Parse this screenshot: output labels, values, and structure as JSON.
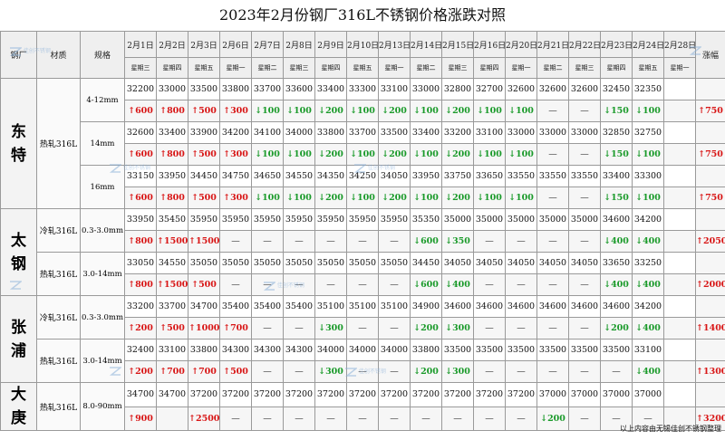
{
  "title": "2023年2月份钢厂316L不锈钢价格涨跌对照",
  "headers": {
    "mill": "钢厂",
    "material": "材质",
    "spec": "规格",
    "dates": [
      "2月1日",
      "2月2日",
      "2月3日",
      "2月6日",
      "2月7日",
      "2月8日",
      "2月9日",
      "2月10日",
      "2月13日",
      "2月14日",
      "2月15日",
      "2月16日",
      "2月20日",
      "2月21日",
      "2月22日",
      "2月23日",
      "2月24日",
      "2月28日"
    ],
    "total": "涨幅"
  },
  "weekdays": [
    "星期三",
    "星期四",
    "星期五",
    "星期一",
    "星期二",
    "星期三",
    "星期四",
    "星期五",
    "星期一",
    "星期二",
    "星期三",
    "星期四",
    "星期一",
    "星期二",
    "星期三",
    "星期四",
    "星期五",
    "星期一"
  ],
  "groups": [
    {
      "mill": "东特",
      "rows": [
        {
          "material": "热轧316L",
          "spec": "4-12mm",
          "prices": [
            "32200",
            "33000",
            "33500",
            "33800",
            "33700",
            "33600",
            "33400",
            "33300",
            "33100",
            "33000",
            "32800",
            "32700",
            "32600",
            "32600",
            "32600",
            "32450",
            "32350",
            ""
          ],
          "changes": [
            [
              "up",
              "600"
            ],
            [
              "up",
              "800"
            ],
            [
              "up",
              "500"
            ],
            [
              "up",
              "300"
            ],
            [
              "dn",
              "100"
            ],
            [
              "dn",
              "100"
            ],
            [
              "dn",
              "200"
            ],
            [
              "dn",
              "100"
            ],
            [
              "dn",
              "200"
            ],
            [
              "dn",
              "100"
            ],
            [
              "dn",
              "200"
            ],
            [
              "dn",
              "100"
            ],
            [
              "dn",
              "100"
            ],
            [
              "eq",
              "—"
            ],
            [
              "eq",
              "—"
            ],
            [
              "dn",
              "150"
            ],
            [
              "dn",
              "100"
            ],
            [
              "",
              ""
            ]
          ],
          "total": "750"
        },
        {
          "material": "",
          "spec": "14mm",
          "prices": [
            "32600",
            "33400",
            "33900",
            "34200",
            "34100",
            "34000",
            "33800",
            "33700",
            "33500",
            "33400",
            "33200",
            "33100",
            "33000",
            "33000",
            "33000",
            "32850",
            "32750",
            ""
          ],
          "changes": [
            [
              "up",
              "600"
            ],
            [
              "up",
              "800"
            ],
            [
              "up",
              "500"
            ],
            [
              "up",
              "300"
            ],
            [
              "dn",
              "100"
            ],
            [
              "dn",
              "100"
            ],
            [
              "dn",
              "200"
            ],
            [
              "dn",
              "100"
            ],
            [
              "dn",
              "200"
            ],
            [
              "dn",
              "100"
            ],
            [
              "dn",
              "200"
            ],
            [
              "dn",
              "100"
            ],
            [
              "dn",
              "100"
            ],
            [
              "eq",
              "—"
            ],
            [
              "eq",
              "—"
            ],
            [
              "dn",
              "150"
            ],
            [
              "dn",
              "100"
            ],
            [
              "",
              ""
            ]
          ],
          "total": "750"
        },
        {
          "material": "",
          "spec": "16mm",
          "prices": [
            "33150",
            "33950",
            "34450",
            "34750",
            "34650",
            "34550",
            "34350",
            "34250",
            "34050",
            "33950",
            "33750",
            "33650",
            "33550",
            "33550",
            "33550",
            "33400",
            "33300",
            ""
          ],
          "changes": [
            [
              "up",
              "600"
            ],
            [
              "up",
              "800"
            ],
            [
              "up",
              "500"
            ],
            [
              "up",
              "300"
            ],
            [
              "dn",
              "100"
            ],
            [
              "dn",
              "100"
            ],
            [
              "dn",
              "200"
            ],
            [
              "dn",
              "100"
            ],
            [
              "dn",
              "200"
            ],
            [
              "dn",
              "100"
            ],
            [
              "dn",
              "200"
            ],
            [
              "dn",
              "100"
            ],
            [
              "dn",
              "100"
            ],
            [
              "eq",
              "—"
            ],
            [
              "eq",
              "—"
            ],
            [
              "dn",
              "150"
            ],
            [
              "dn",
              "100"
            ],
            [
              "",
              ""
            ]
          ],
          "total": "750"
        }
      ]
    },
    {
      "mill": "太钢",
      "rows": [
        {
          "material": "冷轧316L",
          "spec": "0.3-3.0mm",
          "prices": [
            "33950",
            "35450",
            "35950",
            "35950",
            "35950",
            "35950",
            "35950",
            "35950",
            "35950",
            "35350",
            "35000",
            "35000",
            "35000",
            "35000",
            "35000",
            "34600",
            "34200",
            ""
          ],
          "changes": [
            [
              "up",
              "800"
            ],
            [
              "up",
              "1500"
            ],
            [
              "up",
              "1500"
            ],
            [
              "eq",
              "—"
            ],
            [
              "eq",
              "—"
            ],
            [
              "eq",
              "—"
            ],
            [
              "eq",
              "—"
            ],
            [
              "eq",
              "—"
            ],
            [
              "eq",
              "—"
            ],
            [
              "dn",
              "600"
            ],
            [
              "dn",
              "350"
            ],
            [
              "eq",
              "—"
            ],
            [
              "eq",
              "—"
            ],
            [
              "eq",
              "—"
            ],
            [
              "eq",
              "—"
            ],
            [
              "dn",
              "400"
            ],
            [
              "dn",
              "400"
            ],
            [
              "",
              ""
            ]
          ],
          "total": "2050"
        },
        {
          "material": "热轧316L",
          "spec": "3.0-14mm",
          "prices": [
            "33050",
            "34550",
            "35050",
            "35050",
            "35050",
            "35050",
            "35050",
            "35050",
            "35050",
            "34450",
            "34050",
            "34050",
            "34050",
            "34050",
            "34050",
            "33650",
            "33250",
            ""
          ],
          "changes": [
            [
              "up",
              "800"
            ],
            [
              "up",
              "1500"
            ],
            [
              "up",
              "500"
            ],
            [
              "eq",
              "—"
            ],
            [
              "eq",
              "—"
            ],
            [
              "eq",
              "—"
            ],
            [
              "eq",
              "—"
            ],
            [
              "eq",
              "—"
            ],
            [
              "eq",
              "—"
            ],
            [
              "dn",
              "600"
            ],
            [
              "dn",
              "400"
            ],
            [
              "eq",
              "—"
            ],
            [
              "eq",
              "—"
            ],
            [
              "eq",
              "—"
            ],
            [
              "eq",
              "—"
            ],
            [
              "dn",
              "400"
            ],
            [
              "dn",
              "400"
            ],
            [
              "",
              ""
            ]
          ],
          "total": "2000"
        }
      ]
    },
    {
      "mill": "张浦",
      "rows": [
        {
          "material": "冷轧316L",
          "spec": "0.3-3.0mm",
          "prices": [
            "33200",
            "33700",
            "34700",
            "35400",
            "35400",
            "35400",
            "35100",
            "35100",
            "35100",
            "34900",
            "34600",
            "34600",
            "34600",
            "34600",
            "34600",
            "34600",
            "34200",
            ""
          ],
          "changes": [
            [
              "up",
              "200"
            ],
            [
              "up",
              "500"
            ],
            [
              "up",
              "1000"
            ],
            [
              "up",
              "700"
            ],
            [
              "eq",
              "—"
            ],
            [
              "eq",
              "—"
            ],
            [
              "dn",
              "300"
            ],
            [
              "eq",
              "—"
            ],
            [
              "eq",
              "—"
            ],
            [
              "dn",
              "200"
            ],
            [
              "dn",
              "300"
            ],
            [
              "eq",
              "—"
            ],
            [
              "eq",
              "—"
            ],
            [
              "eq",
              "—"
            ],
            [
              "eq",
              "—"
            ],
            [
              "dn",
              "200"
            ],
            [
              "dn",
              "400"
            ],
            [
              "",
              ""
            ]
          ],
          "total": "1400"
        },
        {
          "material": "热轧316L",
          "spec": "3.0-14mm",
          "prices": [
            "32400",
            "33100",
            "33800",
            "34300",
            "34300",
            "34300",
            "34000",
            "34000",
            "34000",
            "33800",
            "33500",
            "33500",
            "33500",
            "33500",
            "33500",
            "33500",
            "33100",
            ""
          ],
          "changes": [
            [
              "up",
              "200"
            ],
            [
              "up",
              "700"
            ],
            [
              "up",
              "700"
            ],
            [
              "up",
              "500"
            ],
            [
              "eq",
              "—"
            ],
            [
              "eq",
              "—"
            ],
            [
              "dn",
              "300"
            ],
            [
              "eq",
              "—"
            ],
            [
              "eq",
              "—"
            ],
            [
              "dn",
              "200"
            ],
            [
              "dn",
              "300"
            ],
            [
              "eq",
              "—"
            ],
            [
              "eq",
              "—"
            ],
            [
              "eq",
              "—"
            ],
            [
              "eq",
              "—"
            ],
            [
              "eq",
              "—"
            ],
            [
              "dn",
              "400"
            ],
            [
              "",
              ""
            ]
          ],
          "total": "1300"
        }
      ]
    },
    {
      "mill": "大庚",
      "rows": [
        {
          "material": "热轧316L",
          "spec": "8.0-90mm",
          "prices": [
            "34700",
            "34700",
            "37200",
            "37200",
            "37200",
            "37200",
            "37200",
            "37200",
            "37200",
            "37200",
            "37200",
            "37200",
            "37200",
            "37000",
            "37000",
            "37000",
            "37000",
            ""
          ],
          "changes": [
            [
              "up",
              "900"
            ],
            [
              "",
              ""
            ],
            [
              "up",
              "2500"
            ],
            [
              "eq",
              "—"
            ],
            [
              "eq",
              "—"
            ],
            [
              "eq",
              "—"
            ],
            [
              "eq",
              "—"
            ],
            [
              "eq",
              "—"
            ],
            [
              "eq",
              "—"
            ],
            [
              "eq",
              "—"
            ],
            [
              "eq",
              "—"
            ],
            [
              "eq",
              "—"
            ],
            [
              "eq",
              "—"
            ],
            [
              "dn",
              "200"
            ],
            [
              "eq",
              "—"
            ],
            [
              "eq",
              "—"
            ],
            [
              "eq",
              "—"
            ],
            [
              "",
              ""
            ]
          ],
          "total": "3200"
        }
      ]
    }
  ],
  "footer": "以上内容由无锡佳创不锈钢整理",
  "watermark": "佳创不锈钢",
  "colors": {
    "up": "#d81515",
    "down": "#1a9a2a",
    "watermark": "#8ab0d8"
  }
}
